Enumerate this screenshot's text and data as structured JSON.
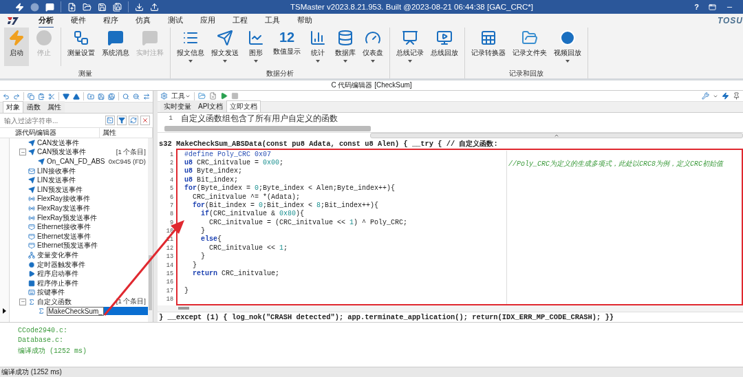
{
  "window": {
    "title": "TSMaster v2023.8.21.953. Built @2023-08-21 06:44:38 [GAC_CRC*]",
    "help": "?"
  },
  "brand": "TOSU",
  "menu": [
    {
      "label": "分析",
      "selected": true
    },
    {
      "label": "硬件",
      "selected": false
    },
    {
      "label": "程序",
      "selected": false
    },
    {
      "label": "仿真",
      "selected": false
    },
    {
      "label": "测试",
      "selected": false
    },
    {
      "label": "应用",
      "selected": false
    },
    {
      "label": "工程",
      "selected": false
    },
    {
      "label": "工具",
      "selected": false
    },
    {
      "label": "帮助",
      "selected": false
    }
  ],
  "ribbon": [
    {
      "label": "测量",
      "sections": [
        [
          {
            "label": "启动",
            "kind": "zap",
            "on": true,
            "disabled": false,
            "has_menu": false
          },
          {
            "label": "停止",
            "kind": "circle",
            "on": false,
            "disabled": true,
            "has_menu": false
          }
        ],
        [
          {
            "label": "测量设置",
            "kind": "tree",
            "on": false,
            "disabled": false,
            "has_menu": false
          },
          {
            "label": "系统消息",
            "kind": "message",
            "on": false,
            "disabled": false,
            "has_menu": false
          },
          {
            "label": "实时注释",
            "kind": "message",
            "on": false,
            "disabled": true,
            "has_menu": false
          }
        ]
      ]
    },
    {
      "label": "数据分析",
      "sections": [
        [
          {
            "label": "报文信息",
            "kind": "list",
            "on": false,
            "disabled": false,
            "has_menu": true
          },
          {
            "label": "报文发送",
            "kind": "send",
            "on": false,
            "disabled": false,
            "has_menu": true
          },
          {
            "label": "图形",
            "kind": "line_chart",
            "on": false,
            "disabled": false,
            "has_menu": true
          },
          {
            "label": "数值显示",
            "kind": "number",
            "icon_text": "12",
            "on": false,
            "disabled": false,
            "has_menu": false
          },
          {
            "label": "统计",
            "kind": "bar_chart",
            "on": false,
            "disabled": false,
            "has_menu": true
          },
          {
            "label": "数据库",
            "kind": "database",
            "on": false,
            "disabled": false,
            "has_menu": true
          },
          {
            "label": "仪表盘",
            "kind": "gauge",
            "on": false,
            "disabled": false,
            "has_menu": true
          }
        ]
      ]
    },
    {
      "sections": [
        [
          {
            "label": "总线记录",
            "kind": "record",
            "on": false,
            "disabled": false,
            "has_menu": true
          },
          {
            "label": "总线回放",
            "kind": "replay",
            "on": false,
            "disabled": false,
            "has_menu": false
          }
        ]
      ]
    },
    {
      "label": "记录和回放",
      "sections": [
        [
          {
            "label": "记录转换器",
            "kind": "table",
            "on": false,
            "disabled": false,
            "has_menu": false
          },
          {
            "label": "记录文件夹",
            "kind": "folder",
            "on": false,
            "disabled": false,
            "has_menu": false
          },
          {
            "label": "视频回放",
            "kind": "play",
            "on": false,
            "disabled": false,
            "has_menu": true
          }
        ]
      ]
    }
  ],
  "editor_window": {
    "title": "C 代码编辑器 [CheckSum]"
  },
  "left_panel": {
    "tabs": [
      {
        "label": "对象",
        "selected": true
      },
      {
        "label": "函数",
        "selected": false
      },
      {
        "label": "属性",
        "selected": false
      }
    ],
    "filter": {
      "placeholder": "输入过滤字符串..."
    },
    "columns": [
      "源代码编辑器",
      "属性"
    ],
    "tree": [
      {
        "label": "CAN发送事件",
        "kind": "send",
        "selected": false
      },
      {
        "label": "CAN预发送事件",
        "kind": "send",
        "value": "[1 个条目]",
        "selected": false,
        "expanded": true,
        "children": [
          {
            "label": "On_CAN_FD_ABS",
            "kind": "send",
            "value": "0xC945 (FD)",
            "selected": false
          }
        ]
      },
      {
        "label": "LIN接收事件",
        "kind": "mail",
        "selected": false
      },
      {
        "label": "LIN发送事件",
        "kind": "send",
        "selected": false
      },
      {
        "label": "LIN预发送事件",
        "kind": "send",
        "selected": false
      },
      {
        "label": "FlexRay接收事件",
        "kind": "flexray",
        "selected": false
      },
      {
        "label": "FlexRay发送事件",
        "kind": "flexray",
        "selected": false
      },
      {
        "label": "FlexRay预发送事件",
        "kind": "flexray",
        "selected": false
      },
      {
        "label": "Ethernet接收事件",
        "kind": "ethernet",
        "selected": false
      },
      {
        "label": "Ethernet发送事件",
        "kind": "ethernet",
        "selected": false
      },
      {
        "label": "Ethernet预发送事件",
        "kind": "ethernet",
        "selected": false
      },
      {
        "label": "变量变化事件",
        "kind": "variable",
        "selected": false
      },
      {
        "label": "定时器触发事件",
        "kind": "timer",
        "selected": false
      },
      {
        "label": "程序启动事件",
        "kind": "start",
        "selected": false
      },
      {
        "label": "程序停止事件",
        "kind": "stop",
        "selected": false
      },
      {
        "label": "按键事件",
        "kind": "key",
        "selected": false
      },
      {
        "label": "自定义函数",
        "kind": "function",
        "value": "[1 个条目]",
        "selected": false,
        "expanded": true,
        "children": [
          {
            "label": "MakeCheckSum_",
            "kind": "function",
            "selected": true
          }
        ]
      }
    ]
  },
  "right_panel": {
    "tools_label": "工具",
    "tabs": [
      {
        "label": "实时变量",
        "selected": false
      },
      {
        "label": "API文档",
        "selected": false
      },
      {
        "label": "立即文档",
        "selected": true
      }
    ],
    "doc_lines": [
      {
        "number": "1",
        "text": "自定义函数组包含了所有用户自定义的函数"
      }
    ],
    "function_header": "s32 MakeCheckSum_ABSData(const pu8 Adata, const u8 Alen) { __try { // 自定义函数:",
    "code_lines": [
      {
        "number": "1",
        "tokens": [
          {
            "kind": "preprocessor",
            "text": "#define Poly_CRC 0x07"
          }
        ]
      },
      {
        "number": "2",
        "tokens": [
          {
            "kind": "keyword",
            "text": "u8"
          },
          {
            "kind": "plain",
            "text": " CRC_initvalue = "
          },
          {
            "kind": "number",
            "text": "0x00"
          },
          {
            "kind": "plain",
            "text": ";"
          }
        ],
        "comment": "//Poly_CRC为定义的生成多项式，此处以CRC8为例，定义CRC初始值"
      },
      {
        "number": "3",
        "tokens": [
          {
            "kind": "keyword",
            "text": "u8"
          },
          {
            "kind": "plain",
            "text": " Byte_index;"
          }
        ]
      },
      {
        "number": "4",
        "tokens": [
          {
            "kind": "keyword",
            "text": "u8"
          },
          {
            "kind": "plain",
            "text": " Bit_index;"
          }
        ]
      },
      {
        "number": "5",
        "tokens": [
          {
            "kind": "keyword",
            "text": "for"
          },
          {
            "kind": "plain",
            "text": "(Byte_index = "
          },
          {
            "kind": "number",
            "text": "0"
          },
          {
            "kind": "plain",
            "text": ";Byte_index < Alen;Byte_index++){"
          }
        ]
      },
      {
        "number": "6",
        "tokens": [
          {
            "kind": "plain",
            "text": "  CRC_initvalue ^= *(Adata);"
          }
        ]
      },
      {
        "number": "7",
        "tokens": [
          {
            "kind": "keyword",
            "text": "  for"
          },
          {
            "kind": "plain",
            "text": "(Bit_index = "
          },
          {
            "kind": "number",
            "text": "0"
          },
          {
            "kind": "plain",
            "text": ";Bit_index < "
          },
          {
            "kind": "number",
            "text": "8"
          },
          {
            "kind": "plain",
            "text": ";Bit_index++){"
          }
        ]
      },
      {
        "number": "8",
        "tokens": [
          {
            "kind": "keyword",
            "text": "    if"
          },
          {
            "kind": "plain",
            "text": "(CRC_initvalue & "
          },
          {
            "kind": "number",
            "text": "0x80"
          },
          {
            "kind": "plain",
            "text": "){"
          }
        ]
      },
      {
        "number": "9",
        "tokens": [
          {
            "kind": "plain",
            "text": "      CRC_initvalue = (CRC_initvalue << "
          },
          {
            "kind": "number",
            "text": "1"
          },
          {
            "kind": "plain",
            "text": ") ^ Poly_CRC;"
          }
        ]
      },
      {
        "number": "10",
        "tokens": [
          {
            "kind": "plain",
            "text": "    }"
          }
        ]
      },
      {
        "number": "11",
        "tokens": [
          {
            "kind": "keyword",
            "text": "    else"
          },
          {
            "kind": "plain",
            "text": "{"
          }
        ]
      },
      {
        "number": "12",
        "tokens": [
          {
            "kind": "plain",
            "text": "      CRC_initvalue << "
          },
          {
            "kind": "number",
            "text": "1"
          },
          {
            "kind": "plain",
            "text": ";"
          }
        ]
      },
      {
        "number": "13",
        "tokens": [
          {
            "kind": "plain",
            "text": "    }"
          }
        ]
      },
      {
        "number": "14",
        "tokens": [
          {
            "kind": "plain",
            "text": "  }"
          }
        ]
      },
      {
        "number": "15",
        "tokens": [
          {
            "kind": "keyword",
            "text": "  return"
          },
          {
            "kind": "plain",
            "text": " CRC_initvalue;"
          }
        ]
      },
      {
        "number": "16"
      },
      {
        "number": "17",
        "tokens": [
          {
            "kind": "plain",
            "text": "}"
          }
        ]
      },
      {
        "number": "18"
      }
    ],
    "function_footer": "} __except (1) { log_nok(\"CRASH detected\"); app.terminate_application(); return(IDX_ERR_MP_CODE_CRASH); }}"
  },
  "output": [
    "CCode2940.c:",
    "Database.c:",
    "编译成功 (1252 ms)"
  ],
  "status_bar": "编译成功 (1252 ms)"
}
